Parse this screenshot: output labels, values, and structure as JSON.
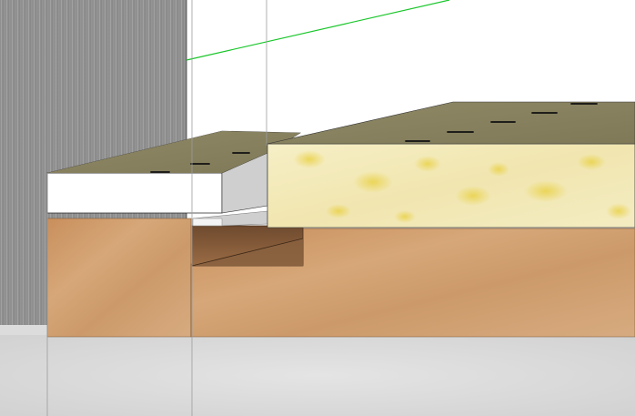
{
  "viewport": {
    "kind": "3d-modeling-viewport",
    "objects": [
      {
        "name": "concrete-wall",
        "material": "brushed-gray-metal",
        "color": "#8f8f8f"
      },
      {
        "name": "floor-slab",
        "material": "light-gray-concrete",
        "color": "#d8d8d8"
      },
      {
        "name": "timber-base",
        "material": "wood",
        "color": "#cf9d6f"
      },
      {
        "name": "timber-recess",
        "material": "dark-wood",
        "color": "#8a6140"
      },
      {
        "name": "white-board",
        "material": "white",
        "color": "#ffffff"
      },
      {
        "name": "insulation-board",
        "material": "yellow-foam",
        "color": "#f2e9b8"
      },
      {
        "name": "olive-top-surfaces",
        "material": "olive-textured",
        "color": "#8b8563"
      }
    ],
    "guides": [
      {
        "name": "green-axis-line",
        "color": "#19c62a"
      },
      {
        "name": "vertical-guide-lines",
        "color": "#9c9c9c"
      }
    ],
    "markers": {
      "name": "fastener-marks",
      "color": "#111111"
    }
  }
}
